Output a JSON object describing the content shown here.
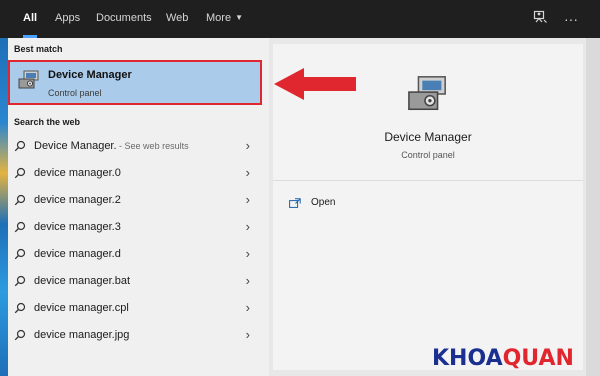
{
  "topbar": {
    "tabs": [
      {
        "label": "All",
        "active": true
      },
      {
        "label": "Apps",
        "active": false
      },
      {
        "label": "Documents",
        "active": false
      },
      {
        "label": "Web",
        "active": false
      },
      {
        "label": "More",
        "active": false
      }
    ],
    "icons": [
      "feedback-icon",
      "more-options-icon"
    ]
  },
  "left": {
    "best_match_label": "Best match",
    "best_match": {
      "title": "Device Manager",
      "subtitle": "Control panel",
      "icon": "device-manager-icon"
    },
    "search_web_label": "Search the web",
    "results": [
      {
        "text": "Device Manager.",
        "hint": " - See web results"
      },
      {
        "text": "device manager.0",
        "hint": ""
      },
      {
        "text": "device manager.2",
        "hint": ""
      },
      {
        "text": "device manager.3",
        "hint": ""
      },
      {
        "text": "device manager.d",
        "hint": ""
      },
      {
        "text": "device manager.bat",
        "hint": ""
      },
      {
        "text": "device manager.cpl",
        "hint": ""
      },
      {
        "text": "device manager.jpg",
        "hint": ""
      }
    ]
  },
  "right": {
    "title": "Device Manager",
    "subtitle": "Control panel",
    "open_label": "Open"
  },
  "watermark": {
    "part1": "KHOA",
    "part2": "QUAN"
  },
  "colors": {
    "accent": "#4aa3ff",
    "highlight": "#aacbe9",
    "annotation_red": "#e0262e",
    "logo_blue": "#1a2f8f"
  }
}
